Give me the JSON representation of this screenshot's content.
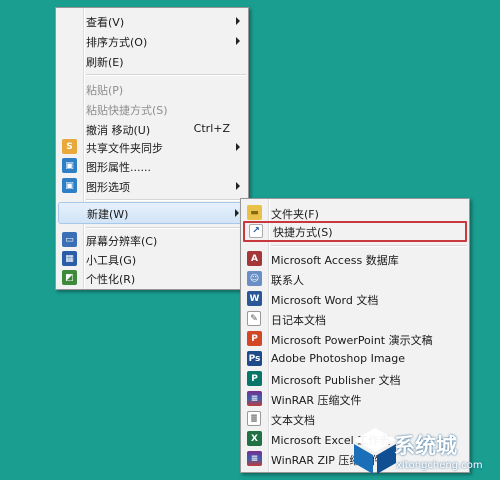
{
  "context_menu": {
    "view": "查看(V)",
    "sort": "排序方式(O)",
    "refresh": "刷新(E)",
    "paste": "粘贴(P)",
    "paste_shortcut": "粘贴快捷方式(S)",
    "undo_move": "撤消 移动(U)",
    "undo_shortcut": "Ctrl+Z",
    "share_sync": "共享文件夹同步",
    "graphics_properties": "图形属性......",
    "graphics_options": "图形选项",
    "new": "新建(W)",
    "screen_resolution": "屏幕分辨率(C)",
    "gadgets": "小工具(G)",
    "personalize": "个性化(R)"
  },
  "submenu": {
    "items": [
      {
        "label": "文件夹(F)",
        "icon": "folder-icon"
      },
      {
        "label": "快捷方式(S)",
        "icon": "shortcut-icon"
      },
      {
        "label": "Microsoft Access 数据库",
        "icon": "access-icon"
      },
      {
        "label": "联系人",
        "icon": "contact-icon"
      },
      {
        "label": "Microsoft Word 文档",
        "icon": "word-icon"
      },
      {
        "label": "日记本文档",
        "icon": "journal-icon"
      },
      {
        "label": "Microsoft PowerPoint 演示文稿",
        "icon": "powerpoint-icon"
      },
      {
        "label": "Adobe Photoshop Image",
        "icon": "photoshop-icon"
      },
      {
        "label": "Microsoft Publisher 文档",
        "icon": "publisher-icon"
      },
      {
        "label": "WinRAR 压缩文件",
        "icon": "winrar-icon"
      },
      {
        "label": "文本文档",
        "icon": "text-document-icon"
      },
      {
        "label": "Microsoft Excel 工作表",
        "icon": "excel-icon"
      },
      {
        "label": "WinRAR ZIP 压缩文件",
        "icon": "winrar-zip-icon"
      }
    ]
  },
  "watermark": {
    "text": "系统城",
    "url": "xitongcheng.com"
  },
  "colors": {
    "desktop": "#199e90",
    "menu_bg": "#f2f2f2",
    "highlight_box": "#c8383c"
  }
}
